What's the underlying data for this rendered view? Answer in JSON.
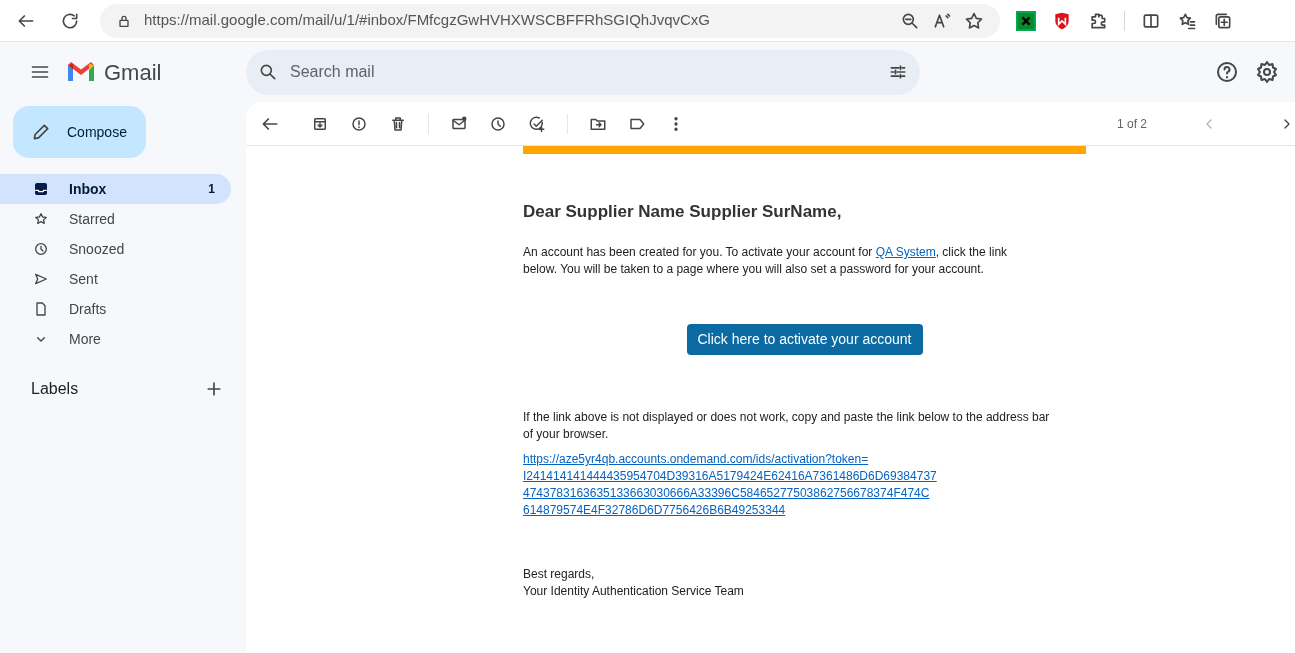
{
  "browser": {
    "url": "https://mail.google.com/mail/u/1/#inbox/FMfcgzGwHVHXWSCBFFRhSGIQhJvqvCxG"
  },
  "app": {
    "name": "Gmail"
  },
  "search": {
    "placeholder": "Search mail"
  },
  "compose": {
    "label": "Compose"
  },
  "sidebar": {
    "items": [
      {
        "label": "Inbox",
        "count": "1",
        "selected": true
      },
      {
        "label": "Starred",
        "selected": false
      },
      {
        "label": "Snoozed",
        "selected": false
      },
      {
        "label": "Sent",
        "selected": false
      },
      {
        "label": "Drafts",
        "selected": false
      },
      {
        "label": "More",
        "selected": false
      }
    ],
    "labels_heading": "Labels"
  },
  "toolbar": {
    "pager": "1 of 2"
  },
  "email": {
    "greeting": "Dear Supplier Name Supplier SurName,",
    "intro": {
      "before": "An account has been created for you. To activate your account for ",
      "link": "QA System",
      "after": ", click the link below. You will be taken to a page where you will also set a password for your account."
    },
    "button": "Click here to activate your account",
    "fallback": "If the link above is not displayed or does not work, copy and paste the link below to the address bar of your browser.",
    "link_lines": [
      "https://aze5yr4qb.accounts.ondemand.com/ids/activation?token=",
      "I241414141444435954704D39316A5179424E62416A7361486D6D69384737",
      "4743783163635133663030666A33396C58465277503862756678374F474C",
      "614879574E4F32786D6D7756426B6B49253344"
    ],
    "signoff": [
      "Best regards,",
      "Your Identity Authentication Service Team"
    ]
  }
}
